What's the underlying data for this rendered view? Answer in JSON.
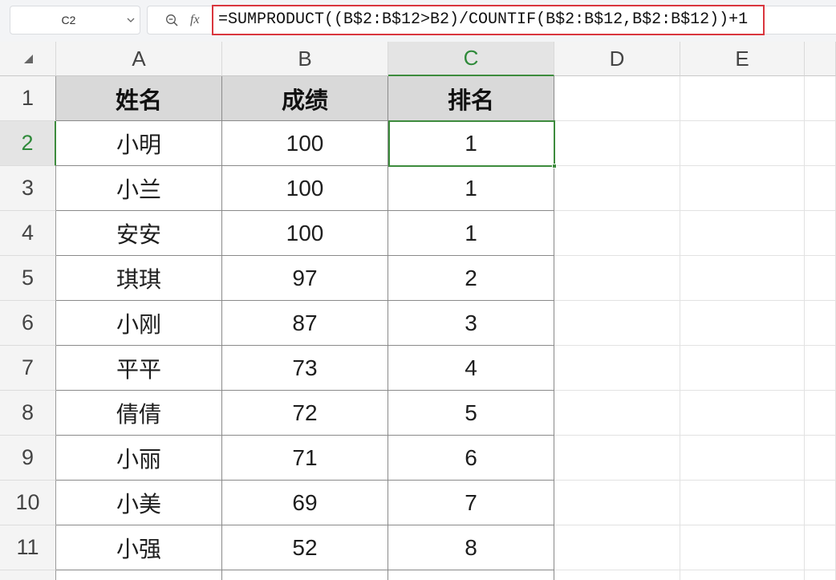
{
  "formula_bar": {
    "name_box": "C2",
    "fx_label": "fx",
    "formula": "=SUMPRODUCT((B$2:B$12>B2)/COUNTIF(B$2:B$12,B$2:B$12))+1"
  },
  "sheet": {
    "columns": [
      "A",
      "B",
      "C",
      "D",
      "E"
    ],
    "row_numbers": [
      "1",
      "2",
      "3",
      "4",
      "5",
      "6",
      "7",
      "8",
      "9",
      "10",
      "11"
    ],
    "header": [
      "姓名",
      "成绩",
      "排名"
    ],
    "rows": [
      [
        "小明",
        "100",
        "1"
      ],
      [
        "小兰",
        "100",
        "1"
      ],
      [
        "安安",
        "100",
        "1"
      ],
      [
        "琪琪",
        "97",
        "2"
      ],
      [
        "小刚",
        "87",
        "3"
      ],
      [
        "平平",
        "73",
        "4"
      ],
      [
        "倩倩",
        "72",
        "5"
      ],
      [
        "小丽",
        "71",
        "6"
      ],
      [
        "小美",
        "69",
        "7"
      ],
      [
        "小强",
        "52",
        "8"
      ]
    ]
  },
  "colors": {
    "selection": "#3d8b3d",
    "formula_highlight": "#d9363e",
    "table_header_bg": "#d9d9d9",
    "header_bg": "#f4f4f4"
  },
  "icons": {
    "name_box_dropdown": "chevron-down-icon",
    "formula_zoom": "zoom-icon",
    "select_all": "select-all-icon"
  }
}
